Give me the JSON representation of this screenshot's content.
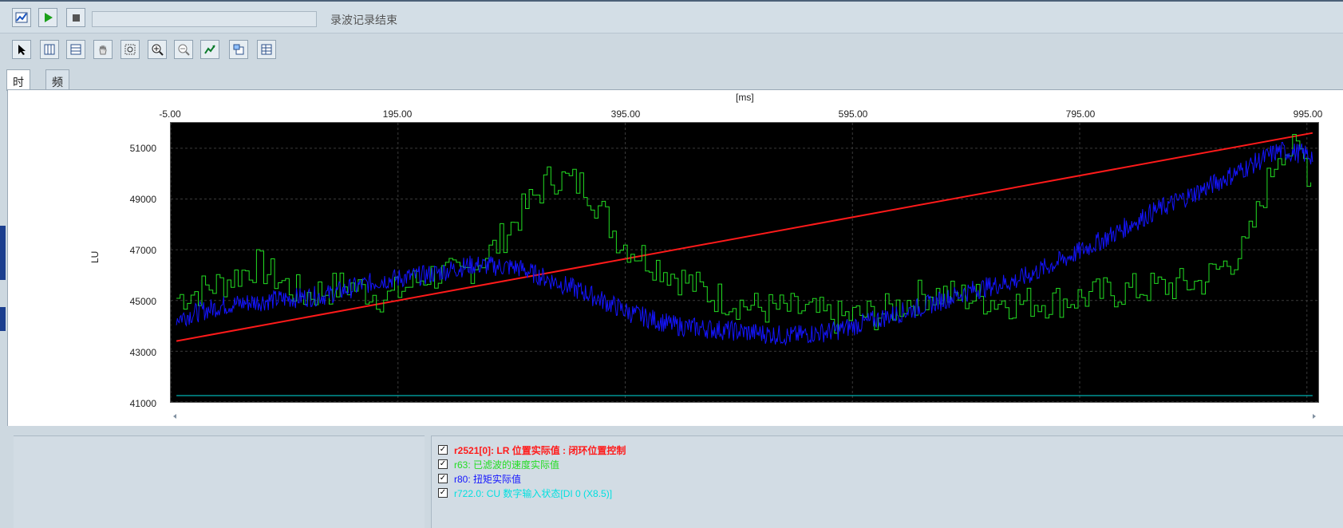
{
  "window": {
    "status_text": "录波记录结束",
    "colors": {
      "background": "#cdd8e0",
      "plot_bg": "#000000"
    }
  },
  "top_toolbar": {
    "buttons": [
      {
        "name": "record-settings-icon"
      },
      {
        "name": "play-icon"
      },
      {
        "name": "stop-icon"
      }
    ]
  },
  "chart_toolbar": {
    "buttons": [
      {
        "name": "pointer-icon"
      },
      {
        "name": "vertical-cursor-icon"
      },
      {
        "name": "horizontal-cursor-icon"
      },
      {
        "name": "pan-hand-icon"
      },
      {
        "name": "zoom-area-icon"
      },
      {
        "name": "zoom-in-icon"
      },
      {
        "name": "zoom-out-icon"
      },
      {
        "name": "auto-scale-icon"
      },
      {
        "name": "export-icon"
      },
      {
        "name": "table-icon"
      }
    ]
  },
  "tabs": [
    {
      "label": "时域"
    },
    {
      "label": "频域"
    }
  ],
  "chart_data": {
    "type": "line",
    "xlabel": "[ms]",
    "ylabel": "LU",
    "xlim": [
      -5,
      1005
    ],
    "ylim": [
      41000,
      52000
    ],
    "x_ticks": [
      "-5.00",
      "195.00",
      "395.00",
      "595.00",
      "795.00",
      "995.00"
    ],
    "y_ticks": [
      "51000",
      "49000",
      "47000",
      "45000",
      "43000",
      "41000"
    ],
    "grid": true,
    "series": [
      {
        "name": "r2521[0]: LR 位置实际值 : 闭环位置控制",
        "color": "#ff1a1a",
        "x": [
          0,
          1000
        ],
        "y": [
          43400,
          51600
        ]
      },
      {
        "name": "r63: 已滤波的速度实际值",
        "color": "#22dd22",
        "x": [
          0,
          40,
          70,
          110,
          150,
          185,
          220,
          250,
          280,
          300,
          330,
          360,
          390,
          430,
          470,
          510,
          550,
          580,
          620,
          660,
          700,
          740,
          780,
          820,
          860,
          900,
          940,
          970,
          990,
          1000
        ],
        "y": [
          45100,
          45700,
          46400,
          45200,
          45600,
          45100,
          46000,
          46000,
          47100,
          48300,
          49900,
          49500,
          47300,
          46200,
          45200,
          44700,
          44600,
          44300,
          44500,
          45300,
          45100,
          44900,
          45000,
          45300,
          45500,
          45700,
          47000,
          51000,
          50800,
          49500
        ]
      },
      {
        "name": "r80: 扭矩实际值",
        "color": "#1414ff",
        "x": [
          0,
          40,
          80,
          130,
          180,
          220,
          260,
          300,
          330,
          360,
          400,
          440,
          490,
          540,
          580,
          620,
          660,
          700,
          740,
          780,
          820,
          860,
          900,
          940,
          970,
          990,
          1000
        ],
        "y": [
          44300,
          44800,
          45000,
          45200,
          45800,
          46000,
          46400,
          46300,
          45800,
          45300,
          44500,
          44000,
          43800,
          43600,
          43800,
          44300,
          44800,
          45400,
          45800,
          46600,
          47500,
          48500,
          49300,
          50200,
          50900,
          50800,
          50700
        ]
      },
      {
        "name": "r722.0: CU 数字输入状态[DI 0 (X8.5)]",
        "color": "#00e0e0",
        "x": [
          0,
          1000
        ],
        "y": [
          41250,
          41250
        ]
      }
    ]
  },
  "legend": {
    "items": [
      {
        "checked": "✓",
        "label": "r2521[0]: LR 位置实际值 : 闭环位置控制",
        "color": "#ff1a1a",
        "bold": true
      },
      {
        "checked": "✓",
        "label": "r63: 已滤波的速度实际值",
        "color": "#22dd22",
        "bold": false
      },
      {
        "checked": "✓",
        "label": "r80: 扭矩实际值",
        "color": "#1414ff",
        "bold": false
      },
      {
        "checked": "✓",
        "label": "r722.0: CU 数字输入状态[DI 0 (X8.5)]",
        "color": "#00e0e0",
        "bold": false
      }
    ]
  }
}
